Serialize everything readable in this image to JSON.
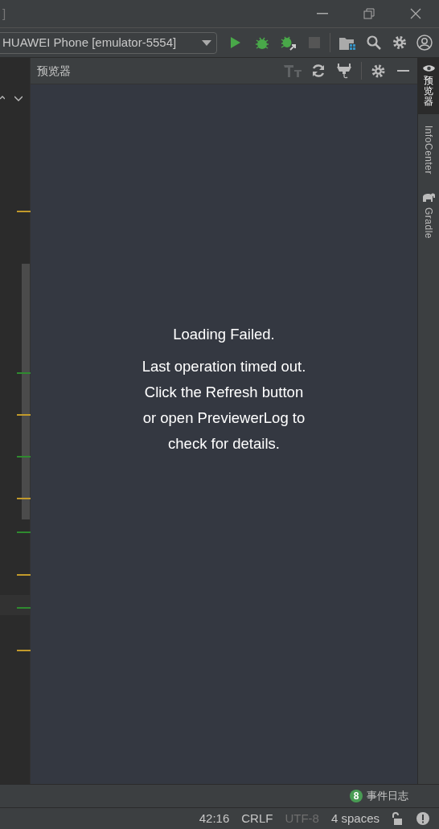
{
  "window": {
    "title": "]"
  },
  "toolbar": {
    "device": "HUAWEI Phone [emulator-5554]",
    "stop_disabled": true
  },
  "editor": {
    "markers": [
      {
        "color": "#c29a2b"
      },
      {
        "color": "#2f8a2f"
      },
      {
        "color": "#c29a2b"
      },
      {
        "color": "#2f8a2f"
      },
      {
        "color": "#c29a2b"
      },
      {
        "color": "#2f8a2f"
      },
      {
        "color": "#c29a2b"
      },
      {
        "color": "#2f8a2f"
      },
      {
        "color": "#c29a2b"
      }
    ]
  },
  "previewer": {
    "title": "预览器",
    "heading": "Loading Failed.",
    "message": "Last operation timed out.\nClick the Refresh button\nor open PreviewerLog to\ncheck for details."
  },
  "side_tabs": [
    {
      "label": "预览器",
      "kind": "cjk",
      "selected": true
    },
    {
      "label": "InfoCenter",
      "kind": "latin",
      "selected": false
    },
    {
      "label": "Gradle",
      "kind": "latin",
      "selected": false
    }
  ],
  "event_log": {
    "count": "8",
    "label": "事件日志"
  },
  "status_bar": [
    {
      "text": "42:16",
      "disabled": false
    },
    {
      "text": "CRLF",
      "disabled": false
    },
    {
      "text": "UTF-8",
      "disabled": true
    },
    {
      "text": "4 spaces",
      "disabled": false
    }
  ]
}
